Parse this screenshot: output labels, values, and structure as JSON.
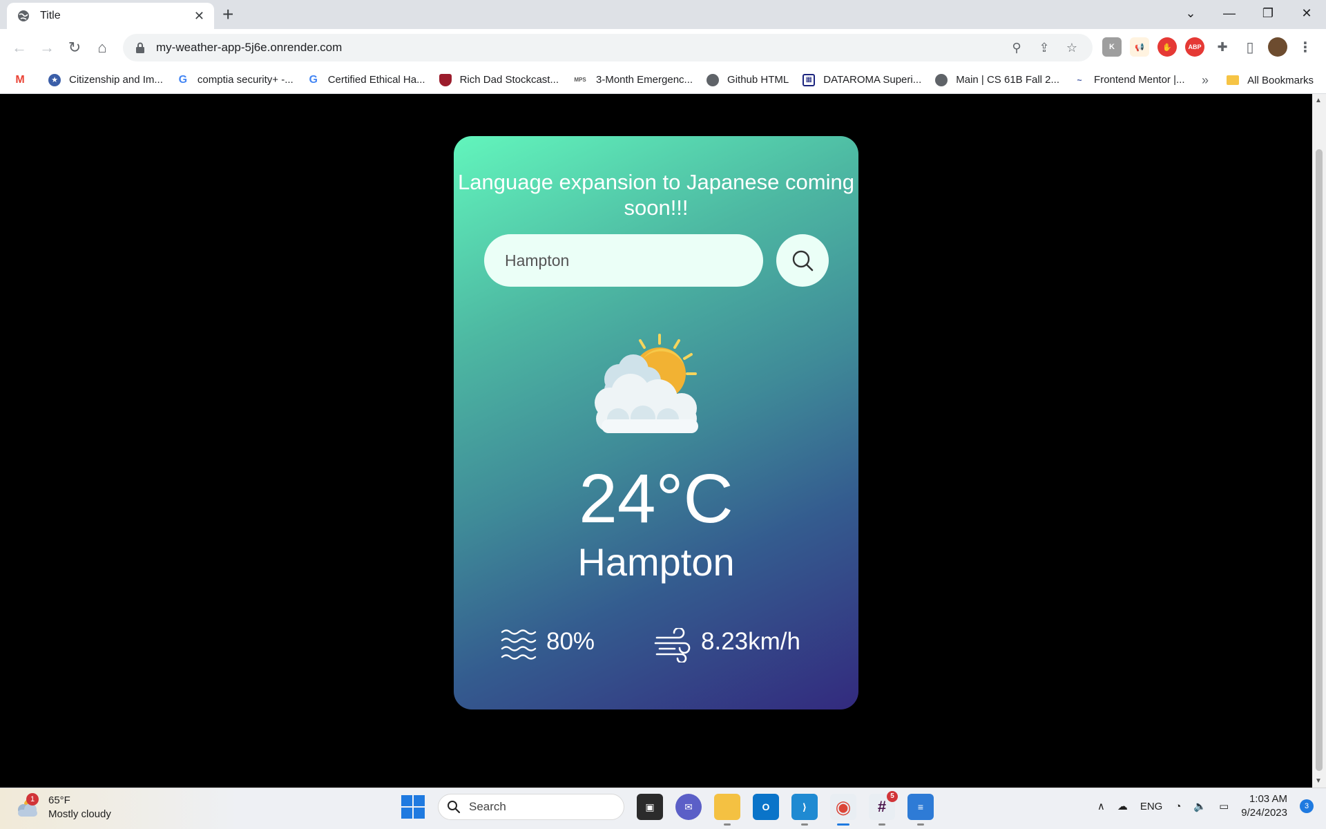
{
  "browser": {
    "tab_title": "Title",
    "new_tab": "+",
    "window_controls": [
      "⌄",
      "—",
      "❐",
      "✕"
    ],
    "url": "my-weather-app-5j6e.onrender.com",
    "bookmarks": [
      {
        "label": "",
        "icon": "gmail-icon",
        "color": "#ea4335"
      },
      {
        "label": "Citizenship and Im...",
        "icon": "seal-icon",
        "color": "#3b5ea8"
      },
      {
        "label": "comptia security+ -...",
        "icon": "google-icon",
        "color": "#4285f4"
      },
      {
        "label": "Certified Ethical Ha...",
        "icon": "google-icon",
        "color": "#4285f4"
      },
      {
        "label": "Rich Dad Stockcast...",
        "icon": "shield-icon",
        "color": "#9b1c2c"
      },
      {
        "label": "3-Month Emergenc...",
        "icon": "mps-icon",
        "color": "#555555"
      },
      {
        "label": "Github HTML",
        "icon": "globe-icon",
        "color": "#5f6368"
      },
      {
        "label": "DATAROMA Superi...",
        "icon": "grid-icon",
        "color": "#1a237e"
      },
      {
        "label": "Main | CS 61B Fall 2...",
        "icon": "globe-icon",
        "color": "#5f6368"
      },
      {
        "label": "Frontend Mentor |...",
        "icon": "fm-icon",
        "color": "#3e54a3"
      }
    ],
    "bookmarks_more": "»",
    "all_bookmarks": "All Bookmarks",
    "extensions": [
      {
        "icon": "k-extension-icon",
        "text": "K",
        "color": "#9e9e9e"
      },
      {
        "icon": "megaphone-extension-icon",
        "text": "📢",
        "color": "#f57c00"
      },
      {
        "icon": "stop-extension-icon",
        "text": "✋",
        "color": "#e53935"
      },
      {
        "icon": "abp-extension-icon",
        "text": "ABP",
        "color": "#e53935"
      },
      {
        "icon": "puzzle-icon",
        "text": "✚",
        "color": "#5f6368"
      },
      {
        "icon": "sidepanel-icon",
        "text": "▯",
        "color": "#5f6368"
      }
    ]
  },
  "app": {
    "banner": "Language expansion to Japanese coming soon!!!",
    "search": {
      "value": "Hampton",
      "placeholder": ""
    },
    "weather_icon": "partly-cloudy-icon",
    "temperature": "24°C",
    "city": "Hampton",
    "humidity": "80%",
    "wind": "8.23km/h"
  },
  "taskbar": {
    "weather_temp": "65°F",
    "weather_desc": "Mostly cloudy",
    "weather_badge": "1",
    "search_label": "Search",
    "slack_badge": "5",
    "language": "ENG",
    "time": "1:03 AM",
    "date": "9/24/2023",
    "notification_count": "3"
  }
}
